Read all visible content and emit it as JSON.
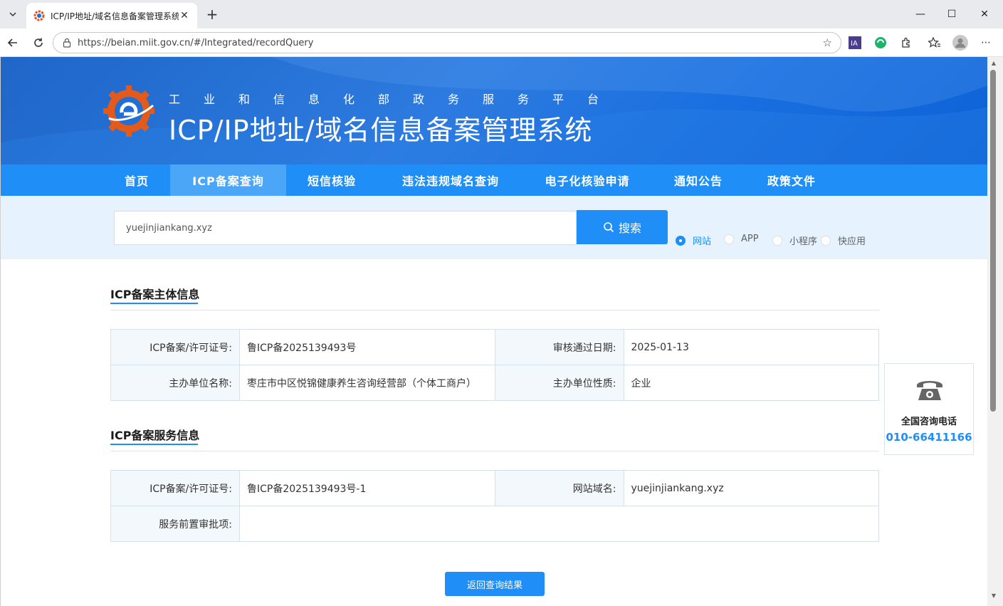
{
  "browser": {
    "tab_title": "ICP/IP地址/域名信息备案管理系统",
    "url": "https://beian.miit.gov.cn/#/Integrated/recordQuery"
  },
  "header": {
    "subtitle": "工业和信息化部政务服务平台",
    "title": "ICP/IP地址/域名信息备案管理系统"
  },
  "nav": {
    "items": [
      {
        "label": "首页"
      },
      {
        "label": "ICP备案查询"
      },
      {
        "label": "短信核验"
      },
      {
        "label": "违法违规域名查询"
      },
      {
        "label": "电子化核验申请"
      },
      {
        "label": "通知公告"
      },
      {
        "label": "政策文件"
      }
    ],
    "active_index": 1
  },
  "search": {
    "value": "yuejinjiankang.xyz",
    "button_label": "搜索",
    "types": [
      {
        "label": "网站",
        "checked": true
      },
      {
        "label": "APP",
        "checked": false
      },
      {
        "label": "小程序",
        "checked": false
      },
      {
        "label": "快应用",
        "checked": false
      }
    ]
  },
  "subject_section": {
    "title": "ICP备案主体信息",
    "rows": [
      [
        {
          "key": "ICP备案/许可证号:",
          "value": "鲁ICP备2025139493号"
        },
        {
          "key": "审核通过日期:",
          "value": "2025-01-13"
        }
      ],
      [
        {
          "key": "主办单位名称:",
          "value": "枣庄市中区悦锦健康养生咨询经营部（个体工商户）"
        },
        {
          "key": "主办单位性质:",
          "value": "企业"
        }
      ]
    ]
  },
  "service_section": {
    "title": "ICP备案服务信息",
    "rows": [
      [
        {
          "key": "ICP备案/许可证号:",
          "value": "鲁ICP备2025139493号-1"
        },
        {
          "key": "网站域名:",
          "value": "yuejinjiankang.xyz"
        }
      ],
      [
        {
          "key": "服务前置审批项:",
          "value": ""
        }
      ]
    ]
  },
  "back_button": {
    "label": "返回查询结果"
  },
  "hotline": {
    "label": "全国咨询电话",
    "number": "010-66411166"
  },
  "colors": {
    "primary": "#1f8ef7",
    "header_bg": "#1f66c8",
    "search_band": "#e6f2fd"
  }
}
